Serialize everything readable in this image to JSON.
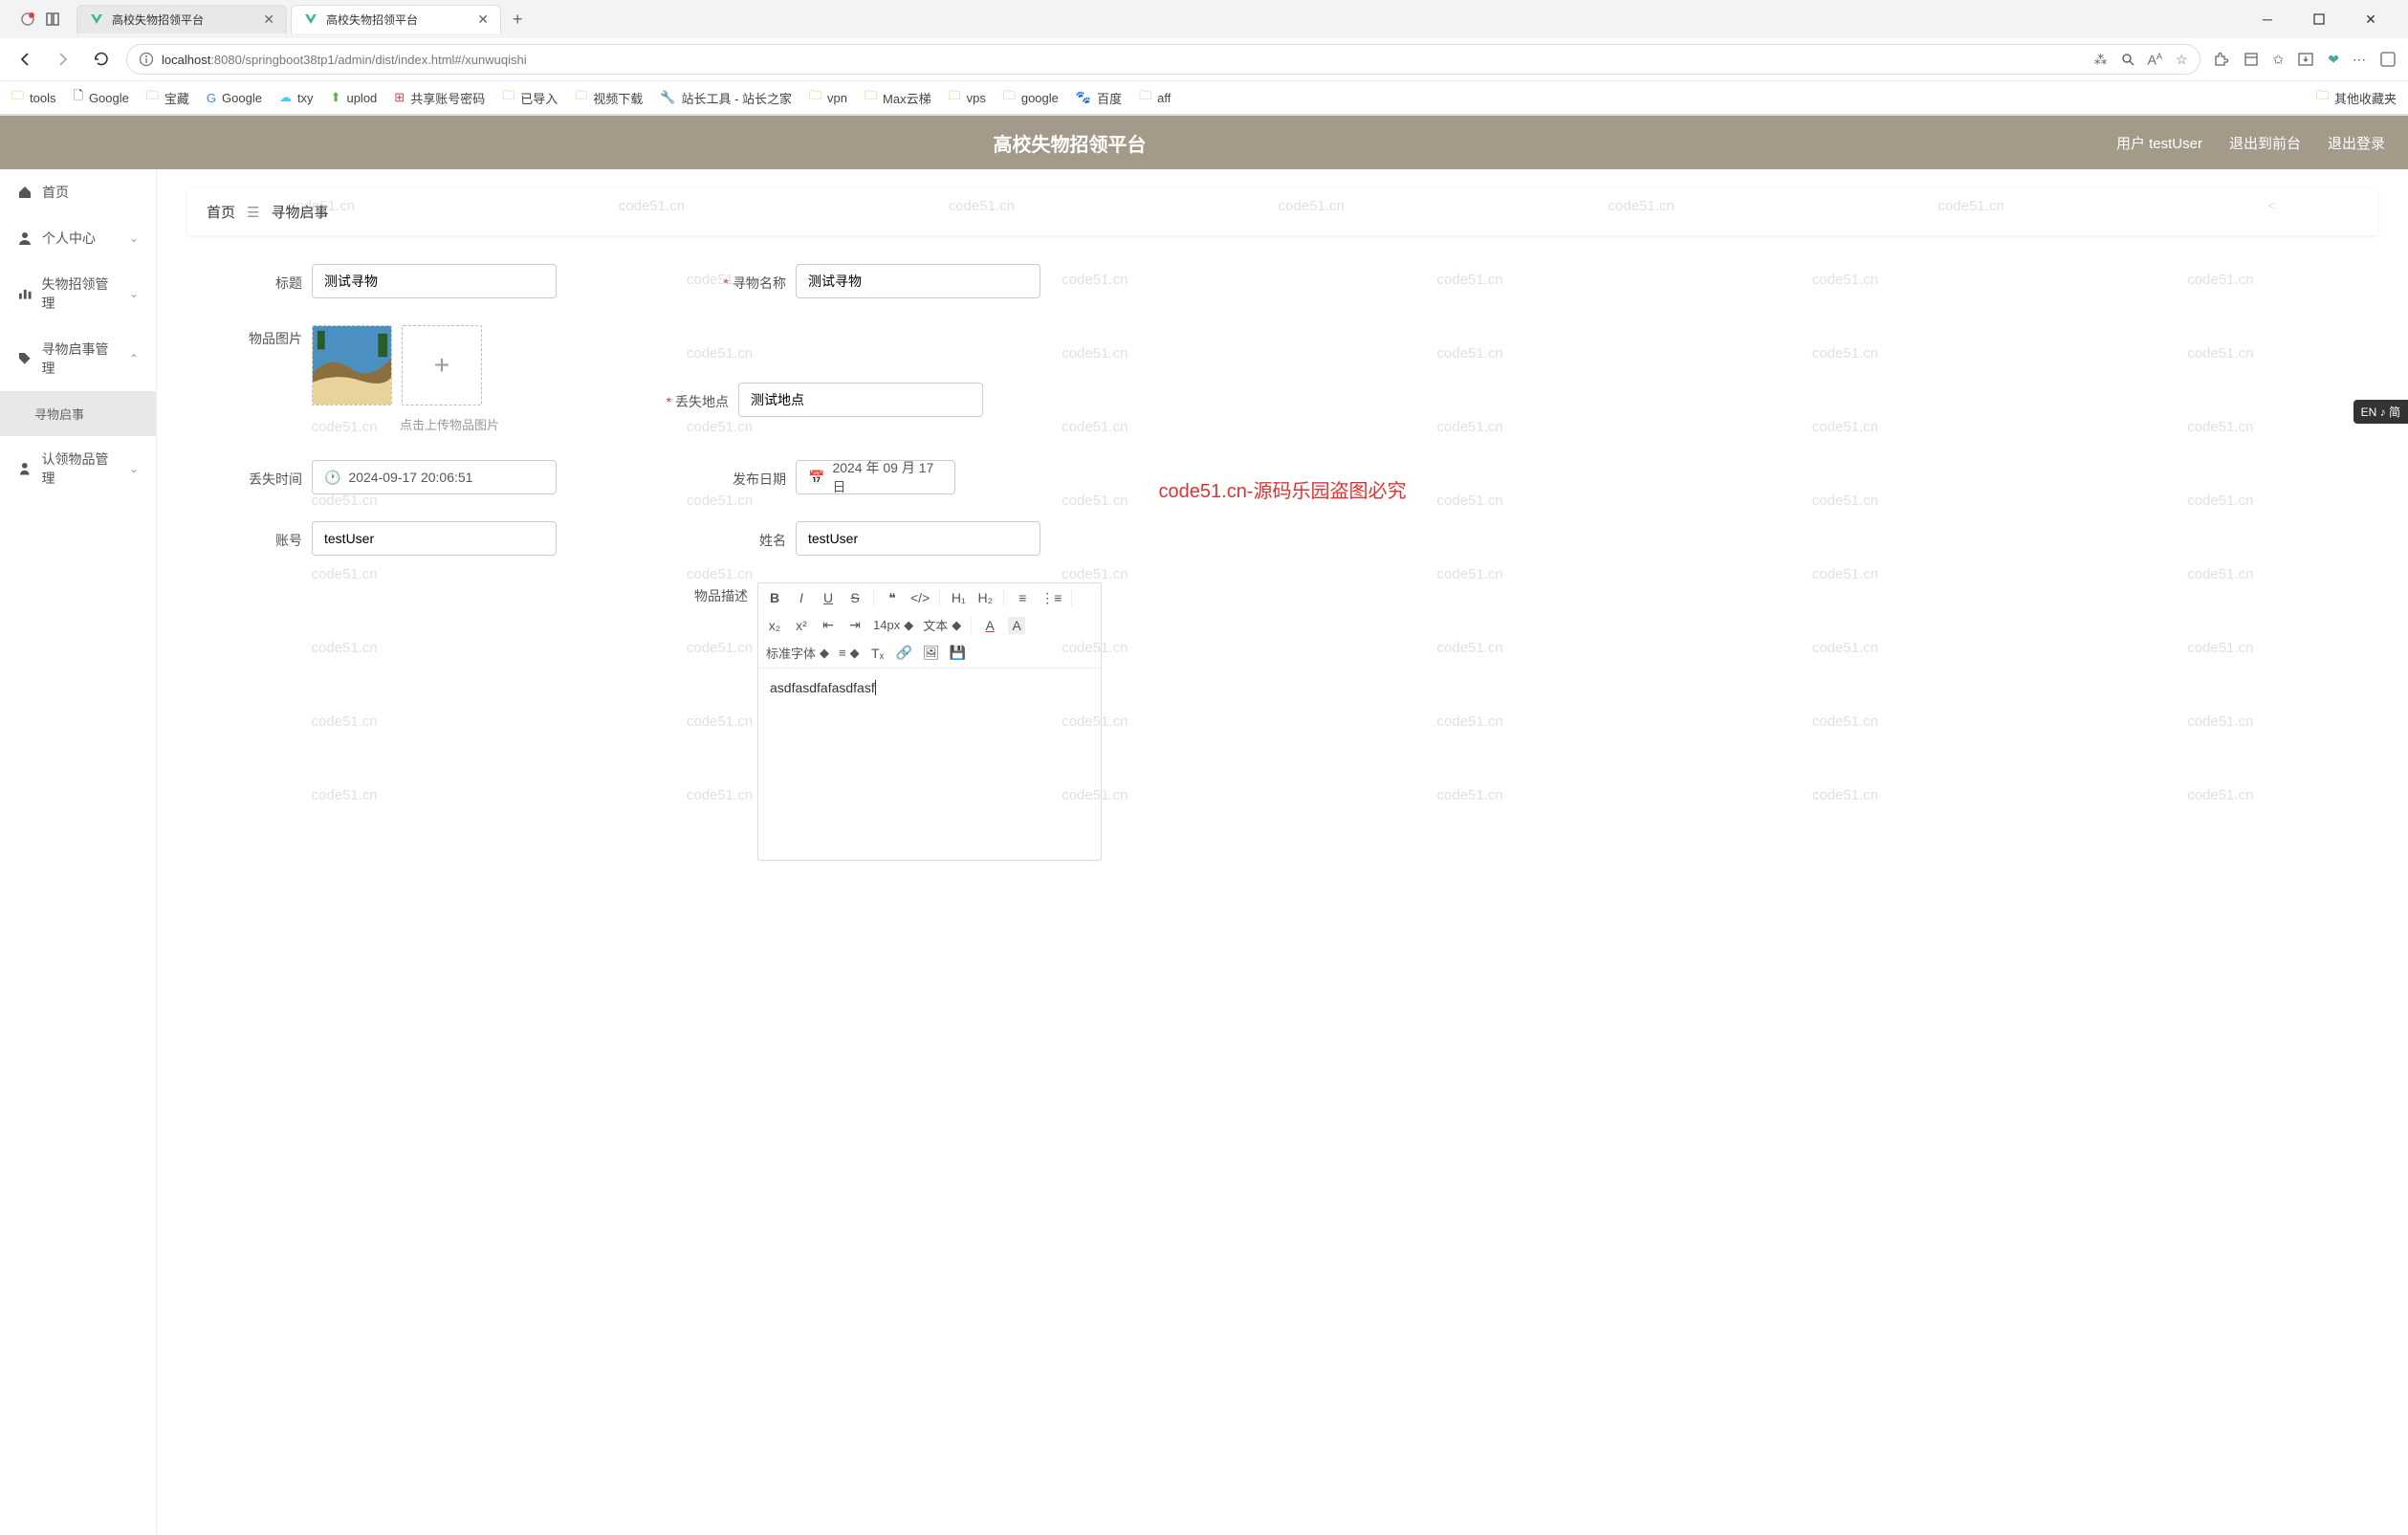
{
  "browser": {
    "tabs": [
      {
        "title": "高校失物招领平台",
        "active": false
      },
      {
        "title": "高校失物招领平台",
        "active": true
      }
    ],
    "url_host": "localhost",
    "url_port": ":8080",
    "url_path": "/springboot38tp1/admin/dist/index.html#/xunwuqishi"
  },
  "bookmarks": {
    "items": [
      "tools",
      "Google",
      "宝藏",
      "Google",
      "txy",
      "uplod",
      "共享账号密码",
      "已导入",
      "视频下载",
      "站长工具 - 站长之家",
      "vpn",
      "Max云梯",
      "vps",
      "google",
      "百度",
      "aff"
    ],
    "right": "其他收藏夹"
  },
  "header": {
    "title": "高校失物招领平台",
    "user_prefix": "用户 ",
    "user": "testUser",
    "back_front": "退出到前台",
    "logout": "退出登录"
  },
  "sidebar": {
    "home": "首页",
    "personal": "个人中心",
    "lost_mgmt": "失物招领管理",
    "seek_mgmt": "寻物启事管理",
    "seek_sub": "寻物启事",
    "claim_mgmt": "认领物品管理"
  },
  "breadcrumb": {
    "home": "首页",
    "current": "寻物启事"
  },
  "form": {
    "title_label": "标题",
    "title_value": "测试寻物",
    "name_label": "寻物名称",
    "name_value": "测试寻物",
    "image_label": "物品图片",
    "image_hint": "点击上传物品图片",
    "lost_place_label": "丢失地点",
    "lost_place_value": "测试地点",
    "lost_time_label": "丢失时间",
    "lost_time_value": "2024-09-17 20:06:51",
    "pub_date_label": "发布日期",
    "pub_date_value": "2024 年 09 月 17 日",
    "account_label": "账号",
    "account_value": "testUser",
    "realname_label": "姓名",
    "realname_value": "testUser",
    "desc_label": "物品描述",
    "editor_font": "标准字体",
    "editor_size": "14px",
    "editor_type": "文本",
    "editor_content": "asdfasdfafasdfasf"
  },
  "watermark": "code51.cn",
  "center_text": "code51.cn-源码乐园盗图必究",
  "lang_badge": "EN ♪ 简"
}
